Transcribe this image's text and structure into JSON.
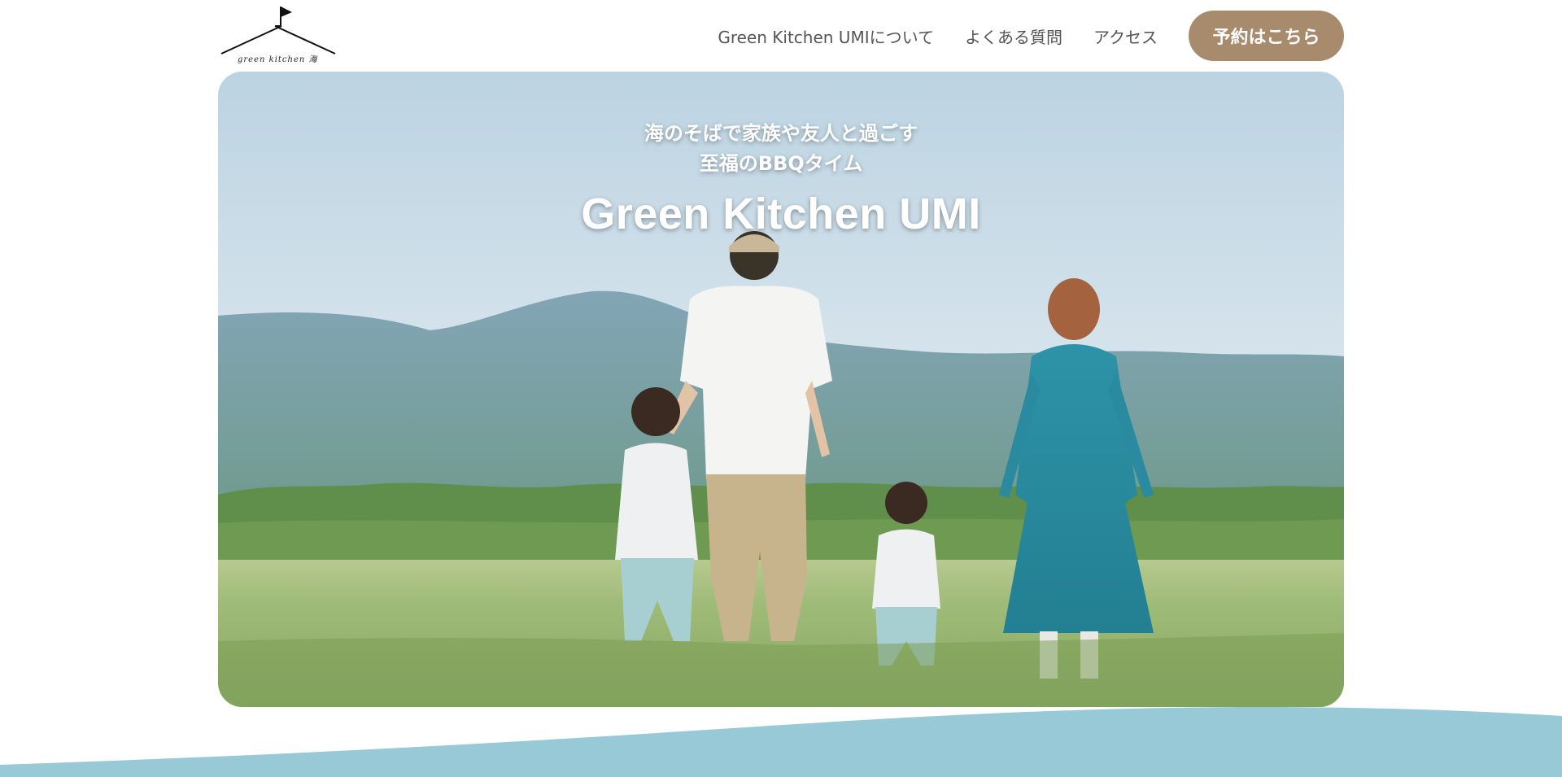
{
  "header": {
    "logo_text": "green kitchen 海",
    "nav": [
      {
        "label": "Green Kitchen UMIについて"
      },
      {
        "label": "よくある質問"
      },
      {
        "label": "アクセス"
      }
    ],
    "reserve_label": "予約はこちら"
  },
  "hero": {
    "subtitle_line1": "海のそばで家族や友人と過ごす",
    "subtitle_line2": "至福のBBQタイム",
    "title": "Green Kitchen UMI"
  },
  "colors": {
    "reserve_button": "#a88a6c",
    "wave": "#98c9d6",
    "text": "#555555"
  }
}
